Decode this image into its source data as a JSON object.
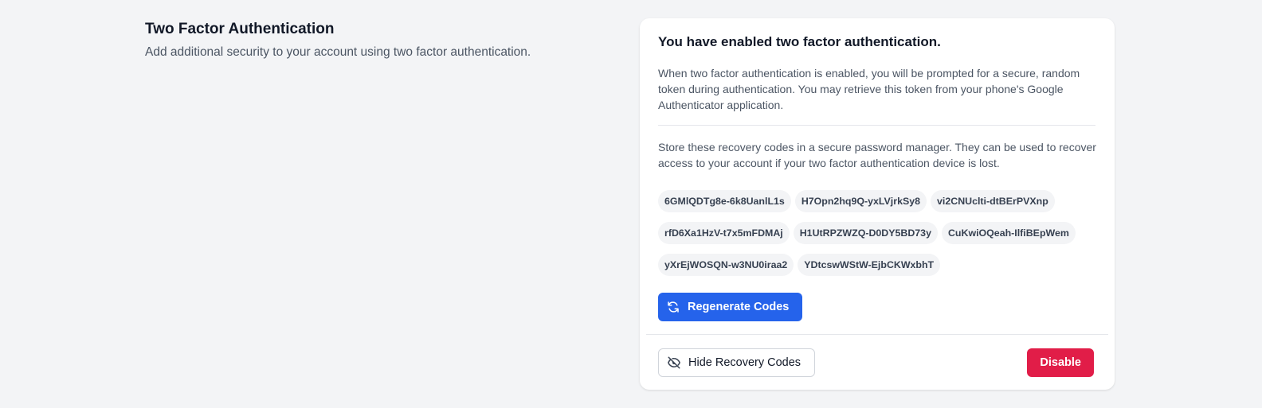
{
  "section": {
    "title": "Two Factor Authentication",
    "description": "Add additional security to your account using two factor authentication."
  },
  "card": {
    "heading": "You have enabled two factor authentication.",
    "intro": "When two factor authentication is enabled, you will be prompted for a secure, random token during authentication. You may retrieve this token from your phone's Google Authenticator application.",
    "store_text": "Store these recovery codes in a secure password manager. They can be used to recover access to your account if your two factor authentication device is lost.",
    "recovery_codes": [
      "6GMlQDTg8e-6k8UanlL1s",
      "H7Opn2hq9Q-yxLVjrkSy8",
      "vi2CNUclti-dtBErPVXnp",
      "rfD6Xa1HzV-t7x5mFDMAj",
      "H1UtRPZWZQ-D0DY5BD73y",
      "CuKwiOQeah-IlfiBEpWem",
      "yXrEjWOSQN-w3NU0iraa2",
      "YDtcswWStW-EjbCKWxbhT"
    ]
  },
  "buttons": {
    "regenerate": {
      "label": "Regenerate Codes",
      "icon": "refresh-icon"
    },
    "hide": {
      "label": "Hide Recovery Codes",
      "icon": "eye-slash-icon"
    },
    "disable": {
      "label": "Disable"
    }
  },
  "colors": {
    "primary": "#2563eb",
    "danger": "#e11d48",
    "background": "#f3f4f6"
  }
}
